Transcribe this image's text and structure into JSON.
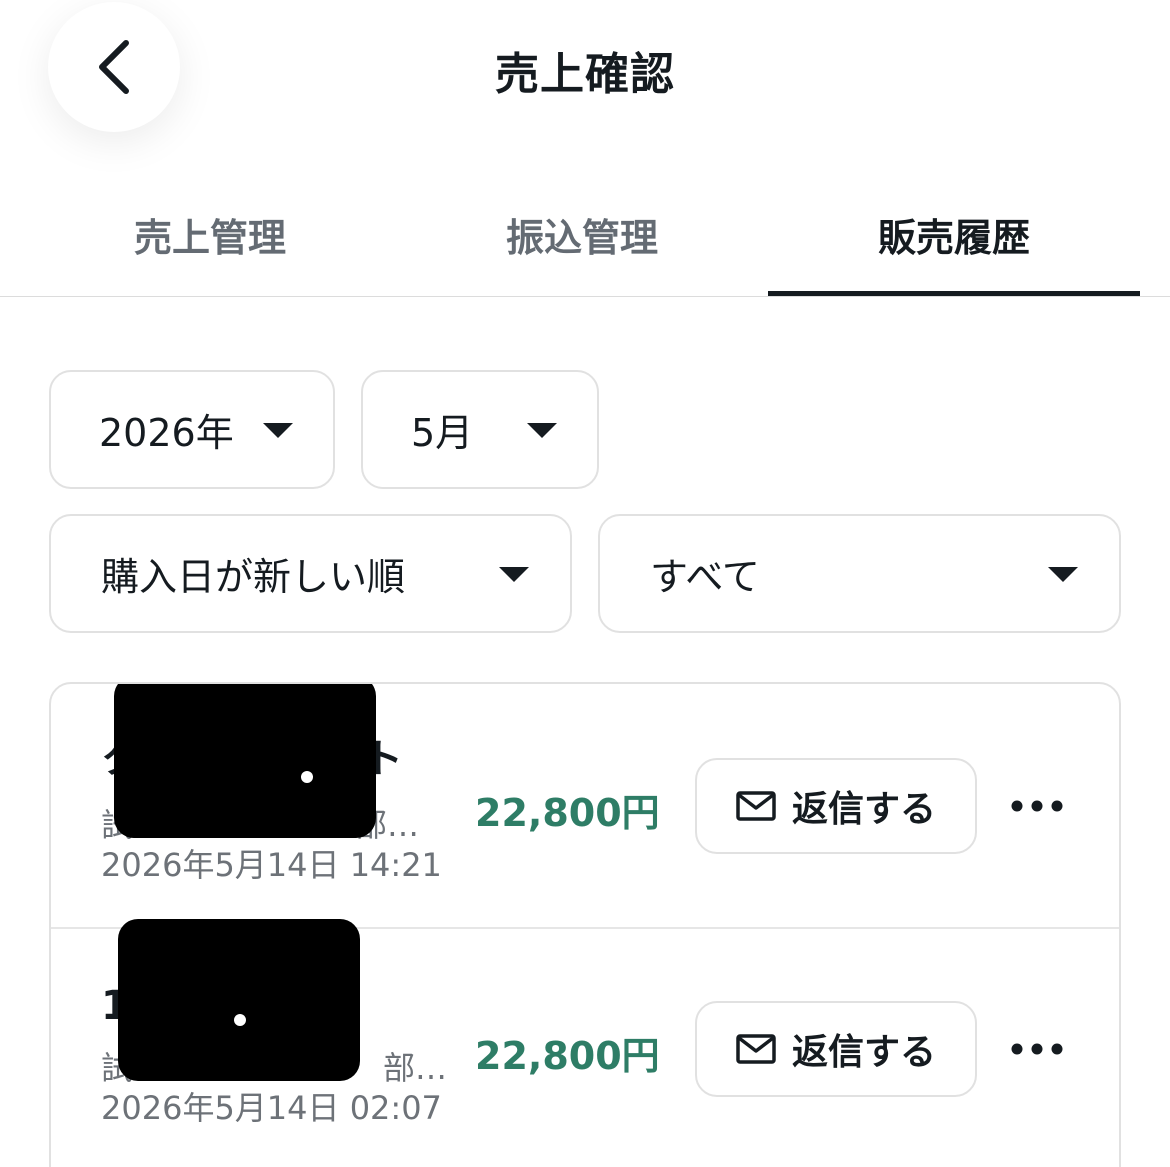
{
  "header": {
    "title": "売上確認",
    "back_icon": "chevron-left-icon"
  },
  "tabs": [
    {
      "label": "売上管理",
      "active": false
    },
    {
      "label": "振込管理",
      "active": false
    },
    {
      "label": "販売履歴",
      "active": true
    }
  ],
  "filters": {
    "year": "2026年",
    "month": "5月",
    "sort": "購入日が新しい順",
    "status": "すべて"
  },
  "sales": [
    {
      "title_visible": "ク",
      "title_end": "ト",
      "subtitle_visible": "試",
      "subtitle_end": "部…",
      "date": "2026年5月14日 14:21",
      "price": "22,800円",
      "reply_label": "返信する"
    },
    {
      "title_visible": "1",
      "title_end": "",
      "subtitle_visible": "試",
      "subtitle_end": "部…",
      "date": "2026年5月14日 02:07",
      "price": "22,800円",
      "reply_label": "返信する"
    }
  ],
  "colors": {
    "price": "#2e7d66",
    "text": "#151b20",
    "muted": "#6d7278",
    "border": "#e1e1e1"
  }
}
